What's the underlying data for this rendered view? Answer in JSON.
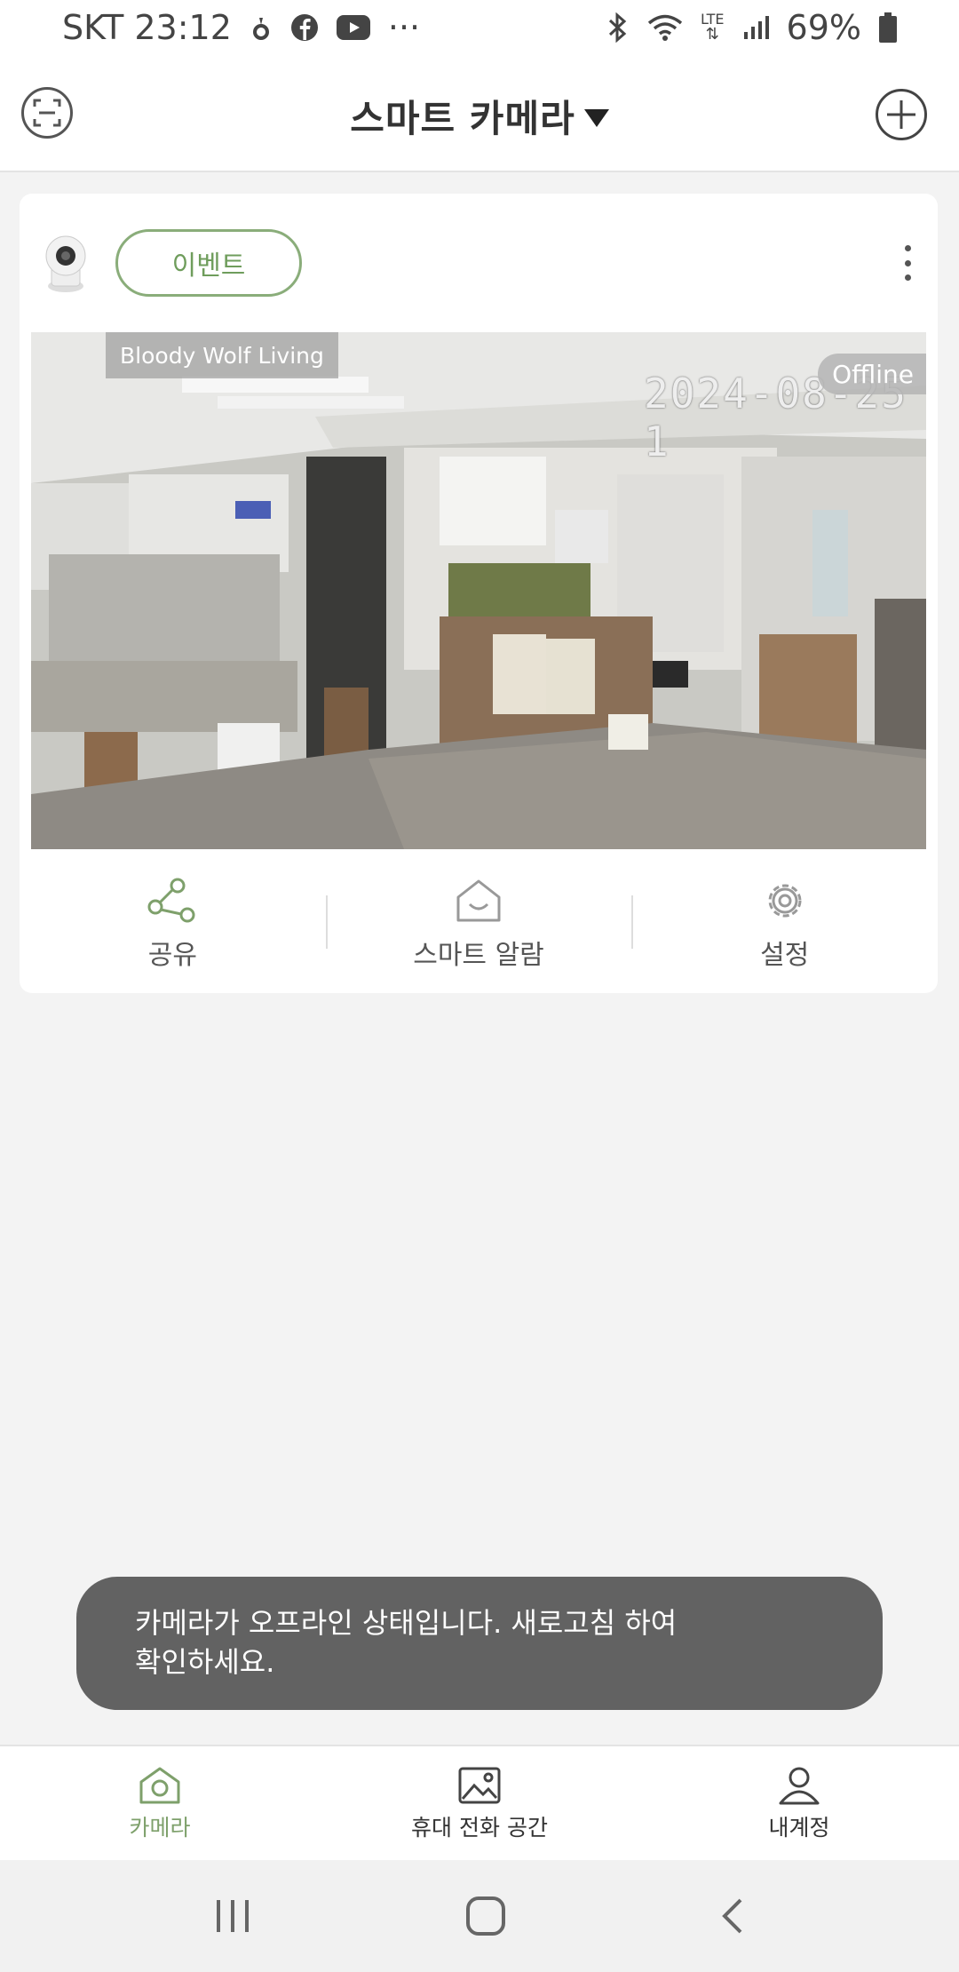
{
  "status_bar": {
    "carrier_time": "SKT 23:12",
    "more": "···",
    "network": "LTE",
    "battery": "69%"
  },
  "header": {
    "title": "스마트 카메라"
  },
  "camera_card": {
    "event_label": "이벤트",
    "camera_name": "Bloody Wolf Living",
    "status": "Offline",
    "timestamp": "2024-08-25 1",
    "actions": [
      {
        "label": "공유",
        "icon": "share-icon"
      },
      {
        "label": "스마트 알람",
        "icon": "home-icon"
      },
      {
        "label": "설정",
        "icon": "gear-icon"
      }
    ]
  },
  "toast": {
    "line1": "카메라가 오프라인 상태입니다. 새로고침 하여",
    "line2": "확인하세요."
  },
  "bottom_nav": {
    "items": [
      {
        "label": "카메라",
        "icon": "camera-home-icon",
        "active": true
      },
      {
        "label": "휴대 전화 공간",
        "icon": "gallery-icon",
        "active": false
      },
      {
        "label": "내계정",
        "icon": "person-icon",
        "active": false
      }
    ]
  },
  "colors": {
    "accent": "#7ea06b",
    "toast_bg": "#626262",
    "background": "#f3f3f3"
  }
}
